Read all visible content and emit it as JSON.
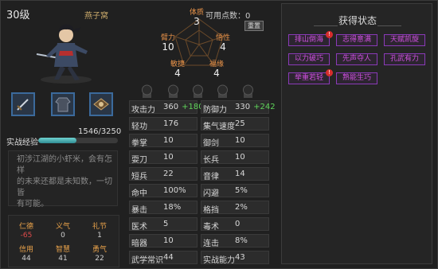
{
  "character": {
    "level": "30级",
    "name": "燕子窝",
    "exp_label": "实战经验",
    "exp_text": "1546/3250",
    "exp_progress": 0.476,
    "description_lines": [
      "初涉江湖的小虾米，会有怎样",
      "的未来还都是未知数，一切皆",
      "有可能。"
    ]
  },
  "equipment": [
    {
      "name": "weapon-slot",
      "icon": "sword-icon"
    },
    {
      "name": "armor-slot",
      "icon": "robe-icon"
    },
    {
      "name": "accessory-slot",
      "icon": "amulet-icon"
    }
  ],
  "traits": [
    {
      "name": "仁德",
      "value": "-65",
      "negative": true
    },
    {
      "name": "义气",
      "value": "0",
      "negative": false
    },
    {
      "name": "礼节",
      "value": "1",
      "negative": false
    },
    {
      "name": "信用",
      "value": "44",
      "negative": false
    },
    {
      "name": "智慧",
      "value": "41",
      "negative": false
    },
    {
      "name": "勇气",
      "value": "22",
      "negative": false
    }
  ],
  "attributes": {
    "points_label": "可用点数：0",
    "reset_label": "重置",
    "items": [
      {
        "name": "体质",
        "value": "3"
      },
      {
        "name": "臂力",
        "value": "10"
      },
      {
        "name": "悟性",
        "value": "4"
      },
      {
        "name": "敏捷",
        "value": "4"
      },
      {
        "name": "福缘",
        "value": "4"
      }
    ]
  },
  "gems": [
    "gem-1",
    "gem-2",
    "gem-3",
    "gem-4",
    "gem-5"
  ],
  "stats": [
    {
      "name": "攻击力",
      "value": "360",
      "bonus": "+180"
    },
    {
      "name": "防御力",
      "value": "330",
      "bonus": "+242"
    },
    {
      "name": "轻功",
      "value": "176",
      "bonus": ""
    },
    {
      "name": "集气速度",
      "value": "25",
      "bonus": ""
    },
    {
      "name": "拳掌",
      "value": "10",
      "bonus": ""
    },
    {
      "name": "御剑",
      "value": "10",
      "bonus": ""
    },
    {
      "name": "耍刀",
      "value": "10",
      "bonus": ""
    },
    {
      "name": "长兵",
      "value": "10",
      "bonus": ""
    },
    {
      "name": "短兵",
      "value": "22",
      "bonus": ""
    },
    {
      "name": "音律",
      "value": "14",
      "bonus": ""
    },
    {
      "name": "命中",
      "value": "100%",
      "bonus": ""
    },
    {
      "name": "闪避",
      "value": "5%",
      "bonus": ""
    },
    {
      "name": "暴击",
      "value": "18%",
      "bonus": ""
    },
    {
      "name": "格挡",
      "value": "2%",
      "bonus": ""
    },
    {
      "name": "医术",
      "value": "5",
      "bonus": ""
    },
    {
      "name": "毒术",
      "value": "0",
      "bonus": ""
    },
    {
      "name": "暗器",
      "value": "10",
      "bonus": ""
    },
    {
      "name": "连击",
      "value": "8%",
      "bonus": ""
    },
    {
      "name": "武学常识",
      "value": "44",
      "bonus": ""
    },
    {
      "name": "实战能力",
      "value": "43",
      "bonus": ""
    }
  ],
  "status_panel": {
    "title": "获得状态",
    "items": [
      {
        "label": "排山倒海",
        "badge": "!"
      },
      {
        "label": "志得意满",
        "badge": ""
      },
      {
        "label": "天赋凯旋",
        "badge": ""
      },
      {
        "label": "以力破巧",
        "badge": ""
      },
      {
        "label": "先声夺人",
        "badge": ""
      },
      {
        "label": "孔武有力",
        "badge": ""
      },
      {
        "label": "举重若轻",
        "badge": "!"
      },
      {
        "label": "熟能生巧",
        "badge": ""
      }
    ]
  },
  "colors": {
    "accent_orange": "#e69148",
    "status_purple": "#d050e0",
    "bonus_green": "#5fd35a",
    "negative_red": "#e04a4a",
    "exp_teal": "#4fb8bd"
  }
}
